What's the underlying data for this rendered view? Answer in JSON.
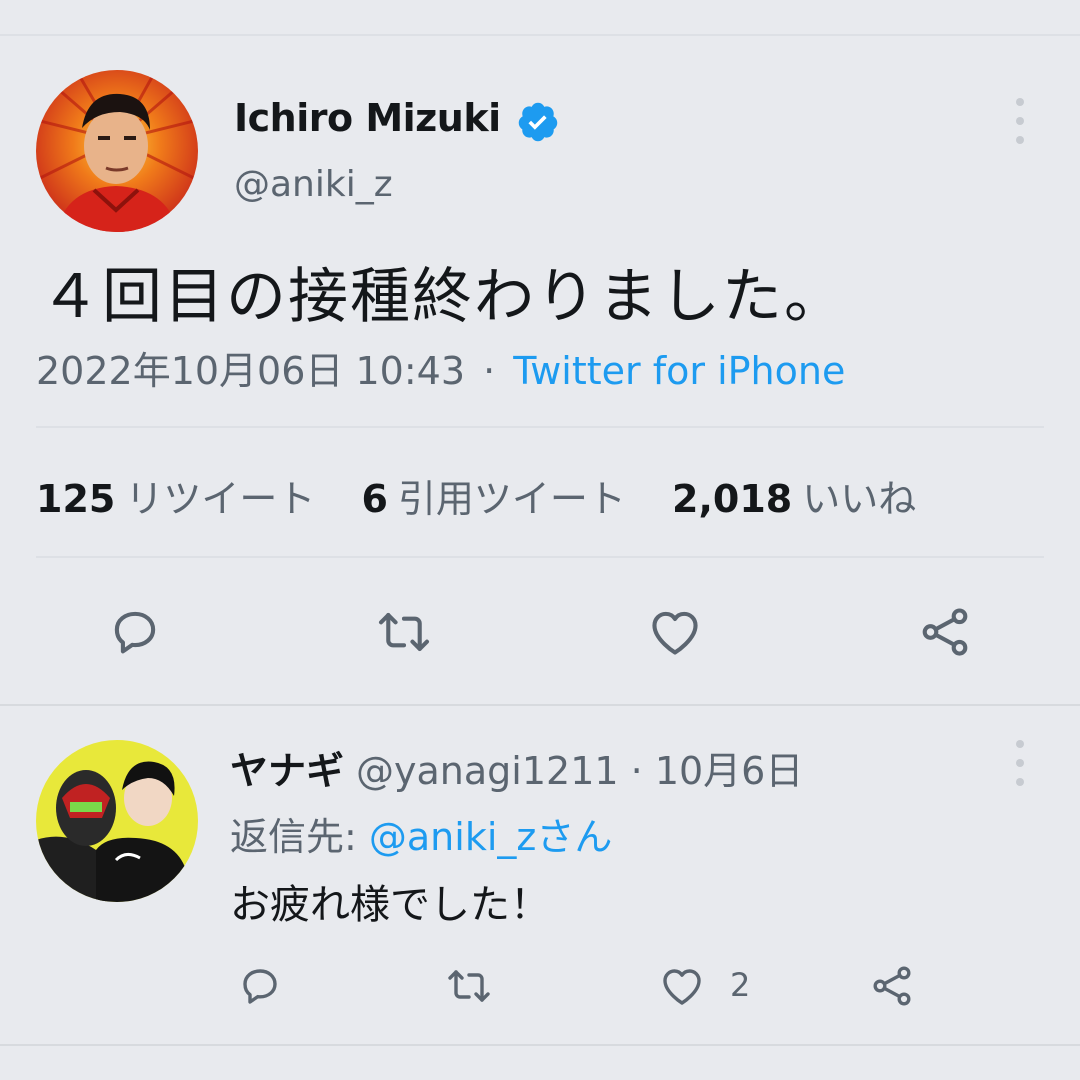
{
  "main_tweet": {
    "display_name": "Ichiro Mizuki",
    "handle": "@aniki_z",
    "text": "４回目の接種終わりました。",
    "datetime": "2022年10月06日 10:43",
    "separator": "·",
    "source": "Twitter for iPhone",
    "stats": [
      {
        "count": "125",
        "label": "リツイート"
      },
      {
        "count": "6",
        "label": "引用ツイート"
      },
      {
        "count": "2,018",
        "label": "いいね"
      }
    ],
    "verified": true
  },
  "reply": {
    "display_name": "ヤナギ",
    "handle": "@yanagi1211",
    "separator": "·",
    "date": "10月6日",
    "reply_to_prefix": "返信先: ",
    "reply_to_mention": "@aniki_z",
    "reply_to_suffix": "さん",
    "text": "お疲れ様でした！",
    "like_count": "2"
  },
  "icons": {
    "reply": "reply-icon",
    "retweet": "retweet-icon",
    "like": "heart-icon",
    "share": "share-icon",
    "more": "more-vertical-icon",
    "verified": "verified-badge-icon"
  },
  "colors": {
    "background": "#e8eaee",
    "text": "#14171a",
    "secondary": "#5b6570",
    "link": "#1d9bf0",
    "verified": "#1d9bf0"
  }
}
